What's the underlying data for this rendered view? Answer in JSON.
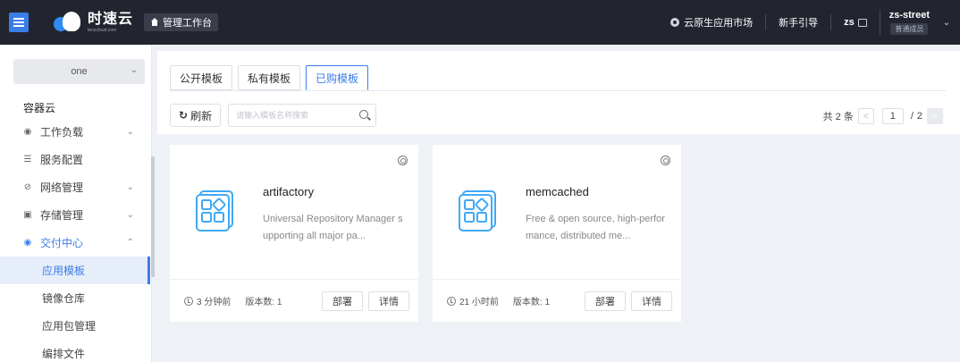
{
  "topbar": {
    "logo_cn": "时速云",
    "logo_en": "tenxcloud.com",
    "workbench_label": "管理工作台",
    "market_label": "云原生应用市场",
    "guide_label": "新手引导",
    "zs_label": "zs",
    "user_name": "zs-street",
    "user_role": "普通成员"
  },
  "sidebar": {
    "namespace": "one",
    "section_title": "容器云",
    "items": [
      {
        "label": "工作负载",
        "icon": "workload-icon",
        "glyph": "◉",
        "chevron": "⌄"
      },
      {
        "label": "服务配置",
        "icon": "config-icon",
        "glyph": "☰",
        "chevron": ""
      },
      {
        "label": "网络管理",
        "icon": "network-icon",
        "glyph": "⊘",
        "chevron": "⌄"
      },
      {
        "label": "存储管理",
        "icon": "storage-icon",
        "glyph": "▣",
        "chevron": "⌄"
      },
      {
        "label": "交付中心",
        "icon": "delivery-icon",
        "glyph": "◉",
        "chevron": "⌃"
      }
    ],
    "sub_items": [
      {
        "label": "应用模板",
        "active": true
      },
      {
        "label": "镜像仓库",
        "active": false
      },
      {
        "label": "应用包管理",
        "active": false
      },
      {
        "label": "编排文件",
        "active": false
      }
    ]
  },
  "main": {
    "tabs": [
      {
        "label": "公开模板",
        "active": false
      },
      {
        "label": "私有模板",
        "active": false
      },
      {
        "label": "已购模板",
        "active": true
      }
    ],
    "refresh_label": "刷新",
    "search_placeholder": "请输入模板名称搜索",
    "pager": {
      "total": "共 2 条",
      "prev": "<",
      "page": "1",
      "slash": "/",
      "pages": "2",
      "next": ">"
    },
    "cards": [
      {
        "name": "artifactory",
        "desc": "Universal Repository Manager supporting all major pa...",
        "time": "3 分钟前",
        "versions": "版本数: 1",
        "deploy": "部署",
        "detail": "详情"
      },
      {
        "name": "memcached",
        "desc": "Free & open source, high-performance, distributed me...",
        "time": "21 小时前",
        "versions": "版本数: 1",
        "deploy": "部署",
        "detail": "详情"
      }
    ]
  },
  "colors": {
    "accent": "#3b7de8",
    "topbar_bg": "#22252f",
    "icon_blue": "#3fa9f5"
  }
}
